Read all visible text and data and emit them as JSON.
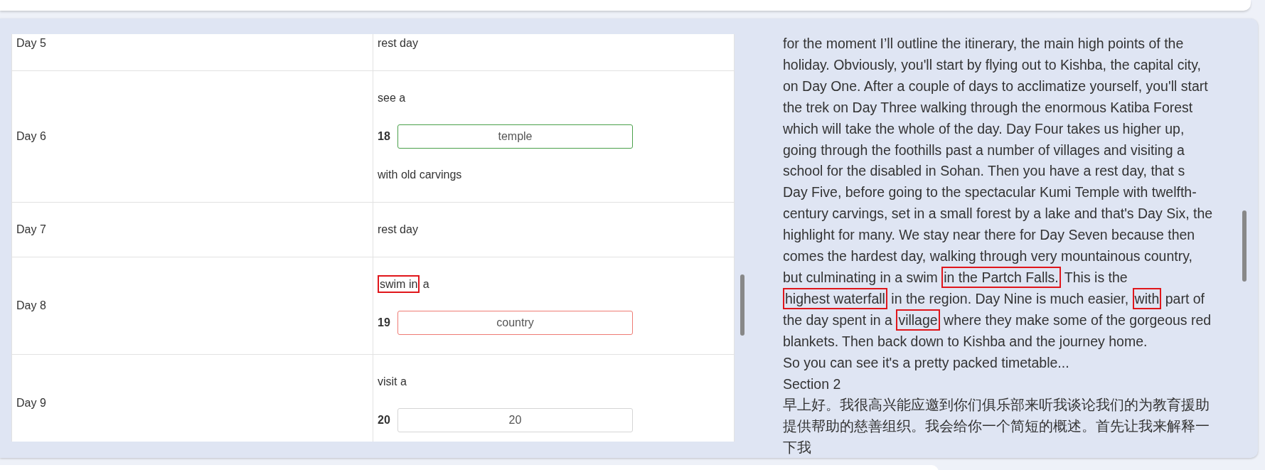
{
  "table": {
    "rows": [
      {
        "day": "Day 5",
        "items": [
          {
            "kind": "text",
            "segments": [
              {
                "text": "rest day",
                "highlighted": false
              }
            ]
          }
        ]
      },
      {
        "day": "Day 6",
        "items": [
          {
            "kind": "text",
            "segments": [
              {
                "text": "see a",
                "highlighted": false
              }
            ]
          },
          {
            "kind": "answer",
            "number": "18",
            "value": "temple",
            "answered": true,
            "correct": true
          },
          {
            "kind": "text",
            "segments": [
              {
                "text": "with old carvings",
                "highlighted": false
              }
            ]
          }
        ]
      },
      {
        "day": "Day 7",
        "items": [
          {
            "kind": "text",
            "segments": [
              {
                "text": "rest day",
                "highlighted": false
              }
            ]
          }
        ]
      },
      {
        "day": "Day 8",
        "items": [
          {
            "kind": "text",
            "segments": [
              {
                "text": "swim in",
                "highlighted": true
              },
              {
                "text": " a",
                "highlighted": false
              }
            ]
          },
          {
            "kind": "answer",
            "number": "19",
            "value": "country",
            "answered": true,
            "correct": false
          }
        ]
      },
      {
        "day": "Day 9",
        "items": [
          {
            "kind": "text",
            "segments": [
              {
                "text": "visit a",
                "highlighted": false
              }
            ]
          },
          {
            "kind": "answer",
            "number": "20",
            "placeholder": "20",
            "answered": false
          }
        ]
      }
    ]
  },
  "transcript": [
    {
      "segments": [
        {
          "text": "for the moment I’ll outline the itinerary, the main high points of the holiday. Obviously, you'll start by flying out to Kishba, the capital city, on Day One. After a couple of days to acclimatize yourself, you'll start the trek on Day Three walking through the enormous Katiba Forest which will take the whole of the day. Day Four takes us higher up, going through the foothills past a number of villages and visiting a school for the disabled in Sohan. Then you have a rest day, that s Day Five, before going to the spectacular Kumi Temple with twelfth-century carvings, set in a small forest by a lake and that's Day Six, the highlight for many. We stay near there for Day Seven because then comes the hardest day, walking through very mountainous country, but culminating in a swim ",
          "highlighted": false
        },
        {
          "text": "in the Partch Falls.",
          "highlighted": true
        },
        {
          "text": " This is the ",
          "highlighted": false
        },
        {
          "text": "highest waterfall",
          "highlighted": true
        },
        {
          "text": " in the region. Day Nine is much easier, ",
          "highlighted": false
        },
        {
          "text": "with",
          "highlighted": true
        },
        {
          "text": " part of the day spent in a ",
          "highlighted": false
        },
        {
          "text": "village",
          "highlighted": true
        },
        {
          "text": " where they make some of the gorgeous red blankets. Then back down to Kishba and the journey home.",
          "highlighted": false
        }
      ]
    },
    {
      "segments": [
        {
          "text": "So you can see it's a pretty packed timetable...",
          "highlighted": false
        }
      ]
    },
    {
      "segments": [
        {
          "text": "Section 2",
          "highlighted": false
        }
      ]
    },
    {
      "segments": [
        {
          "text": "早上好。我很高兴能应邀到你们俱乐部来听我谈论我们的为教育援助提供帮助的慈善组织。我会给你一个简短的概述。首先让我来解释一下我",
          "highlighted": false
        }
      ]
    }
  ]
}
